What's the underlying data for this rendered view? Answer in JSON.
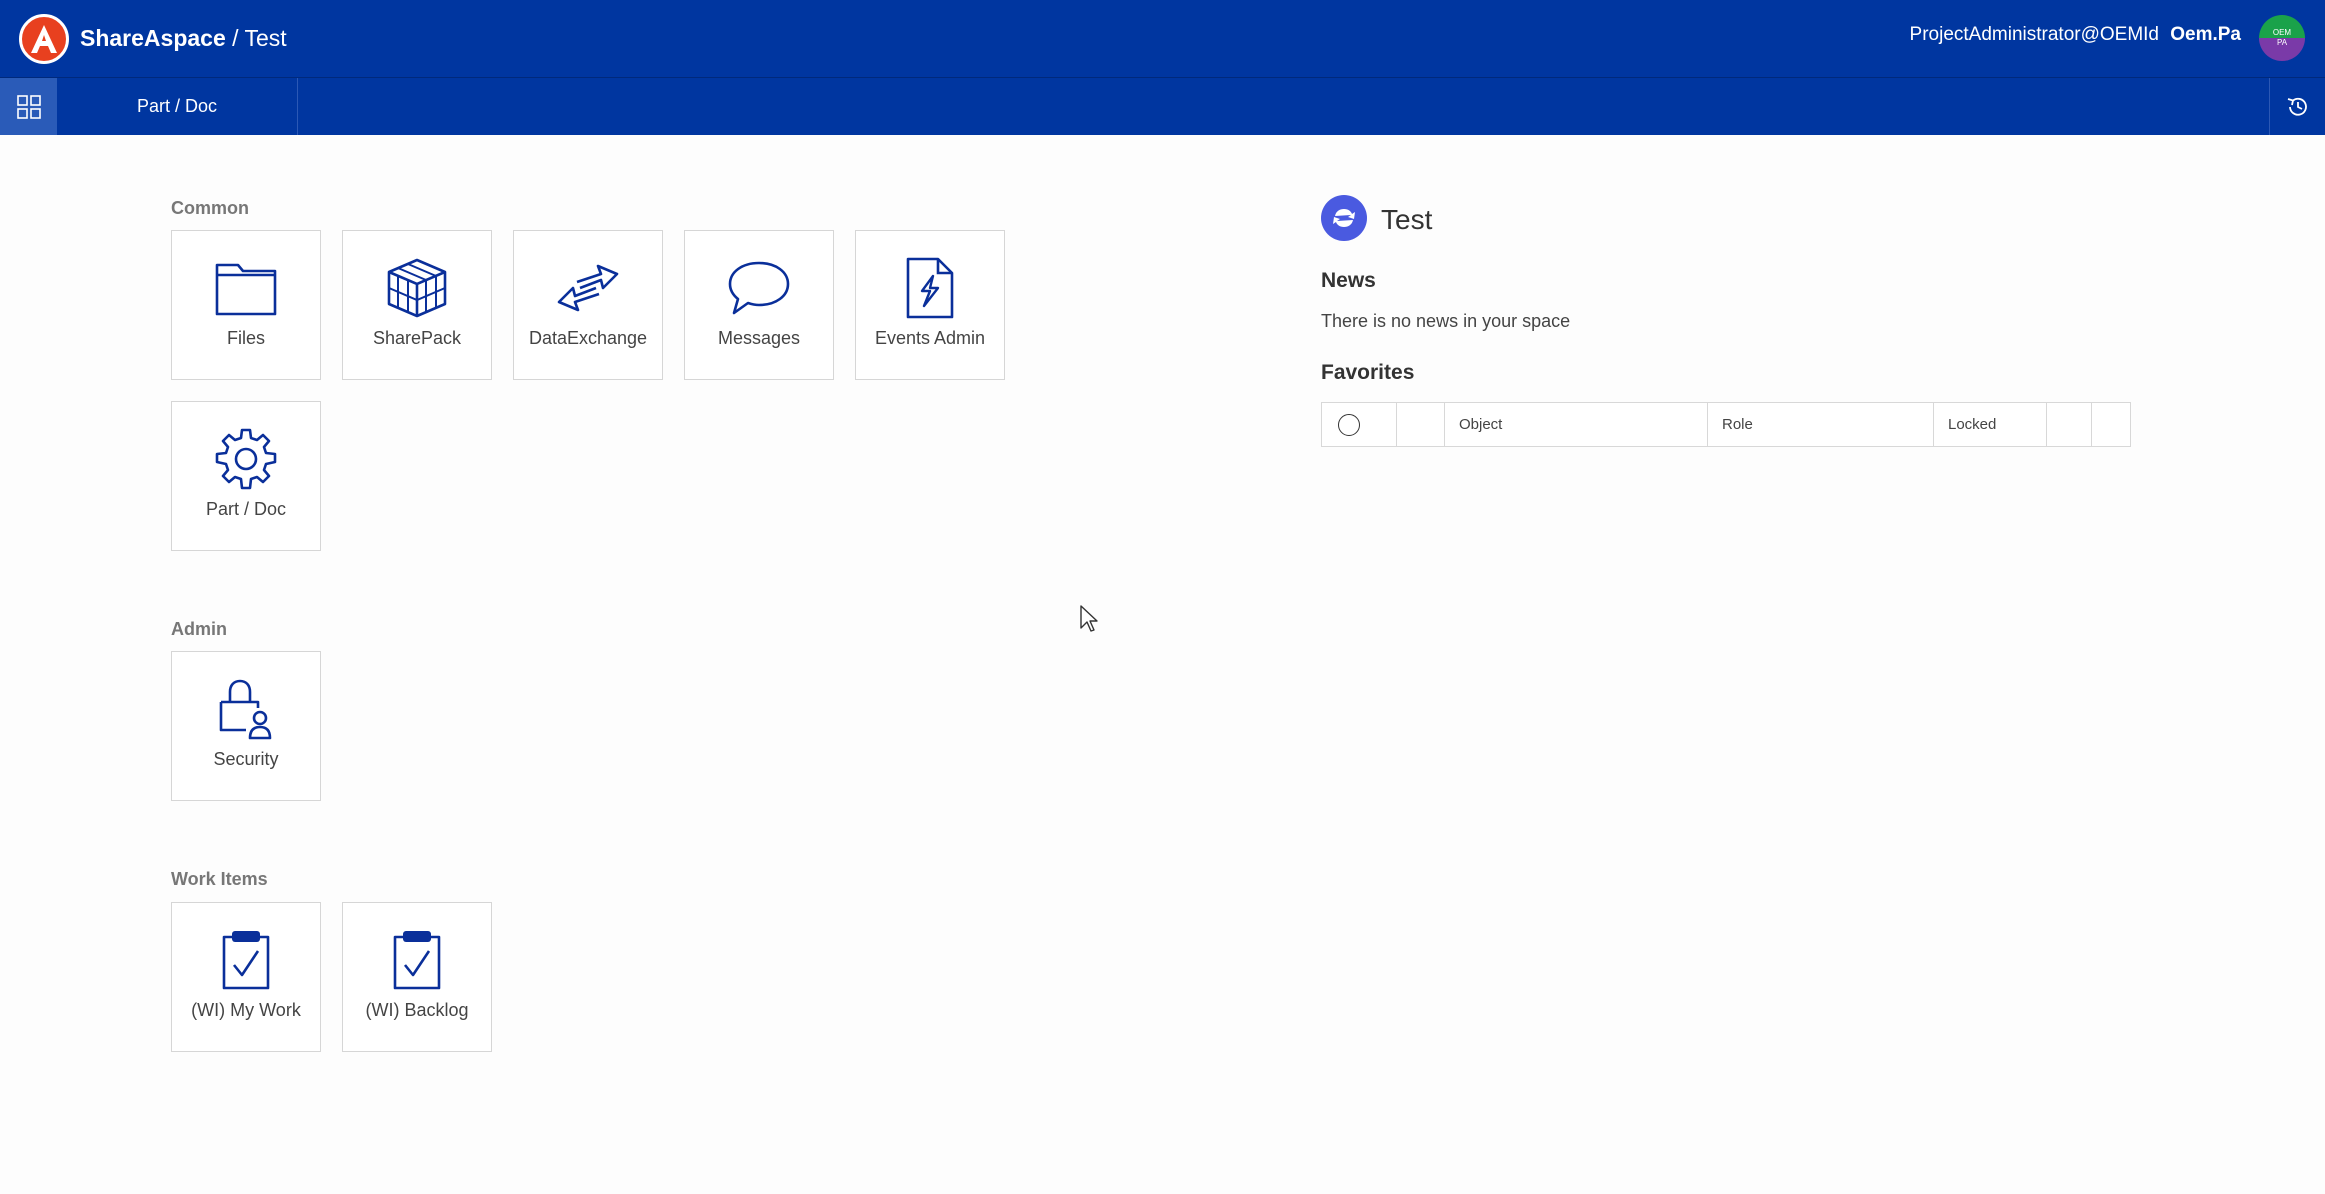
{
  "header": {
    "brand": "ShareAspace",
    "separator": " / ",
    "space": "Test",
    "user_email": "ProjectAdministrator@OEMId",
    "user_name": "Oem.Pa",
    "avatar_top": "OEM",
    "avatar_bottom": "PA"
  },
  "subbar": {
    "active_tab": "Part / Doc"
  },
  "sections": {
    "common": {
      "label": "Common",
      "tiles": [
        {
          "label": "Files",
          "icon": "folder-icon"
        },
        {
          "label": "SharePack",
          "icon": "cube-package-icon"
        },
        {
          "label": "DataExchange",
          "icon": "exchange-arrows-icon"
        },
        {
          "label": "Messages",
          "icon": "speech-bubble-icon"
        },
        {
          "label": "Events Admin",
          "icon": "lightning-document-icon"
        },
        {
          "label": "Part / Doc",
          "icon": "gear-icon"
        }
      ]
    },
    "admin": {
      "label": "Admin",
      "tiles": [
        {
          "label": "Security",
          "icon": "lock-user-icon"
        }
      ]
    },
    "work_items": {
      "label": "Work Items",
      "tiles": [
        {
          "label": "(WI) My Work",
          "icon": "clipboard-check-icon"
        },
        {
          "label": "(WI) Backlog",
          "icon": "clipboard-check-icon"
        }
      ]
    }
  },
  "panel": {
    "title": "Test",
    "news_heading": "News",
    "news_text": "There is no news in your space",
    "favorites_heading": "Favorites",
    "columns": [
      "Object",
      "Role",
      "Locked"
    ]
  },
  "colors": {
    "brand_blue": "#0036a0",
    "icon_blue": "#0a2f9a",
    "logo_orange": "#e8401f"
  }
}
